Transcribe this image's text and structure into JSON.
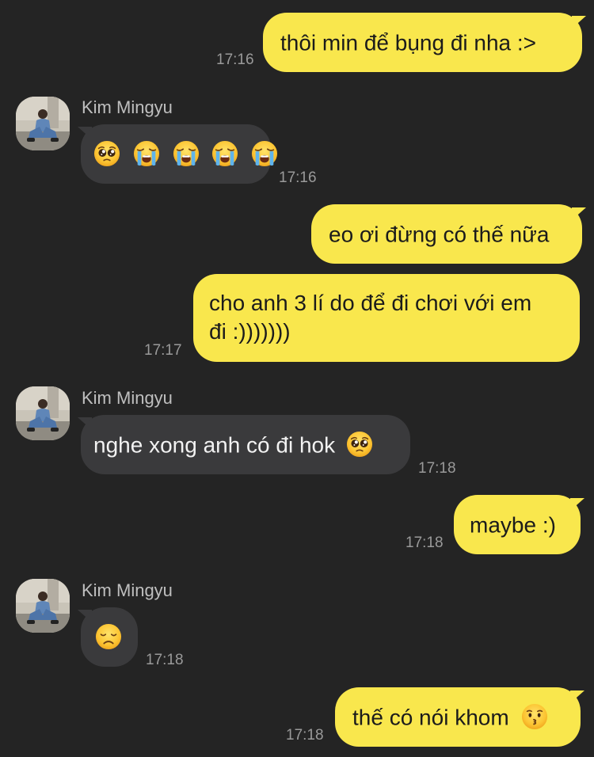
{
  "contact": {
    "name": "Kim Mingyu",
    "avatar_icon": "profile-photo-avatar"
  },
  "colors": {
    "background": "#242424",
    "outgoing_bubble": "#f9e74d",
    "incoming_bubble": "#3a3a3c",
    "timestamp": "#9a9a9a"
  },
  "messages": [
    {
      "direction": "outgoing",
      "text": "thôi min để bụng đi nha :>",
      "time": "17:16"
    },
    {
      "direction": "incoming",
      "sender": "Kim Mingyu",
      "emojis": [
        "pleading-face-icon",
        "loudly-crying-face-icon",
        "loudly-crying-face-icon",
        "loudly-crying-face-icon",
        "loudly-crying-face-icon"
      ],
      "time": "17:16"
    },
    {
      "direction": "outgoing",
      "text": "eo ơi đừng có thế nữa"
    },
    {
      "direction": "outgoing",
      "line1": "cho anh 3 lí do để đi chơi với em",
      "line2": "đi :)))))))",
      "time": "17:17"
    },
    {
      "direction": "incoming",
      "sender": "Kim Mingyu",
      "text": "nghe xong anh có đi hok",
      "emoji": "pleading-face-icon",
      "time": "17:18"
    },
    {
      "direction": "outgoing",
      "text": "maybe :)",
      "time": "17:18"
    },
    {
      "direction": "incoming",
      "sender": "Kim Mingyu",
      "emoji": "disappointed-face-icon",
      "time": "17:18"
    },
    {
      "direction": "outgoing",
      "text": "thế có nói khom",
      "emoji": "kissing-face-icon",
      "time": "17:18"
    }
  ]
}
